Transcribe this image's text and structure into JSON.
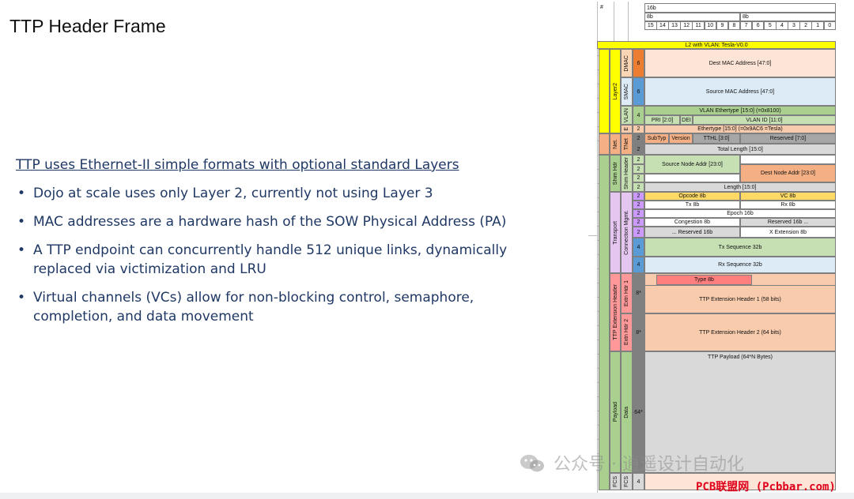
{
  "slide": {
    "title": "TTP Header Frame",
    "lead": "TTP uses Ethernet-II simple formats with optional standard Layers",
    "bullets": [
      "Dojo at scale uses only Layer 2, currently not using Layer 3",
      "MAC addresses are a hardware hash of the SOW Physical Address (PA)",
      "A TTP endpoint can concurrently handle 512 unique links, dynamically replaced via victimization and LRU",
      "Virtual channels (VCs) allow for non-blocking control, semaphore, completion, and data movement"
    ]
  },
  "colors": {
    "yellow": "#ffff00",
    "orange_label": "#fcd5b4",
    "orange_num": "#ed7d31",
    "mac_fill": "#fce4d6",
    "smac_fill": "#ddebf7",
    "blue_num": "#5b9bd5",
    "green": "#a9d08e",
    "green_light": "#c6e0b4",
    "red_light": "#f8cbad",
    "pink": "#ff9999",
    "gray_dark": "#808080",
    "gray": "#a6a6a6",
    "gray_light": "#d9d9d9",
    "purple": "#e4c6f0",
    "purple_num": "#cc99ff",
    "salmon": "#f4b084"
  },
  "diagram": {
    "top": {
      "hash": "#",
      "w16": "16b",
      "w8a": "8b",
      "w8b": "8b",
      "bits": [
        "15",
        "14",
        "13",
        "12",
        "11",
        "10",
        "9",
        "8",
        "7",
        "6",
        "5",
        "4",
        "3",
        "2",
        "1",
        "0"
      ]
    },
    "l2_title": "L2 with VLAN: Tesla-V0.0",
    "groups": {
      "layer2": "Layer2",
      "net": "Net.",
      "shim_hdr": "Shim Hdr",
      "transport": "Transport",
      "ttp_ext": "TTP Extension Header",
      "payload": "Payload",
      "fcs": "FCS"
    },
    "subs": {
      "dmac": "DMAC",
      "smac": "SMAC",
      "vlan": "VLAN",
      "e": "E",
      "tnet": "TNet",
      "shim_header": "Shim Header",
      "conn_mgmt": "Connection Mgmt.",
      "ext1": "Extn Hdr 1",
      "ext2": "Extn Hdr 2",
      "data": "Data",
      "fcs": "FCS"
    },
    "nums": {
      "dmac": "6",
      "smac": "6",
      "vlan": "4",
      "e": "2",
      "tnet1": "2",
      "tnet2": "2",
      "shim1": "2",
      "shim2": "2",
      "shim3": "2",
      "shim4": "2",
      "tr1": "2",
      "tr2": "2",
      "tr3": "2",
      "tr4": "2",
      "tr5": "2",
      "tr6": "4",
      "tr7": "4",
      "ext1": "8*",
      "ext2": "8*",
      "data": "64*",
      "fcs": "4"
    },
    "fields": {
      "dest_mac": "Dest MAC Address [47:0]",
      "src_mac": "Source MAC Address [47:0]",
      "vlan_eth": "VLAN Ethertype [15:0] (=0x8100)",
      "pri": "PRI [2:0]",
      "dei": "DEI",
      "vlan_id": "VLAN ID [11:0]",
      "ethertype": "Ethertype [15:0] (=0x9AC6 =Tesla)",
      "subtyp": "SubTyp",
      "version": "Version",
      "tthl": "TTHL [3:0]",
      "reserved7": "Reserved [7:0]",
      "total_len": "Total Length [15:0]",
      "src_node": "Source Node Addr [23:0]",
      "dst_node": "Dest Node Addr  [23:0]",
      "length": "Length [15:0]",
      "opcode": "Opcode 8b",
      "vc": "VC 8b",
      "tx8": "Tx 8b",
      "rx8": "Rx 8b",
      "epoch": "Epoch 16b",
      "congestion": "Congestion 8b",
      "reserved16a": "Reserved 16b ...",
      "reserved16b": "... Reserved 16b",
      "xext": "X Extension 8b",
      "txseq": "Tx Sequence 32b",
      "rxseq": "Rx Sequence 32b",
      "type8": "Type 8b",
      "ext1": "TTP Extension Header 1 (58 bits)",
      "ext2": "TTP Extension Header 2 (64 bits)",
      "payload": "TTP Payload (64*N Bytes)"
    }
  },
  "watermark": "公众号 · 逍遥设计自动化",
  "brand": "PCB联盟网 (Pcbbar.com)"
}
